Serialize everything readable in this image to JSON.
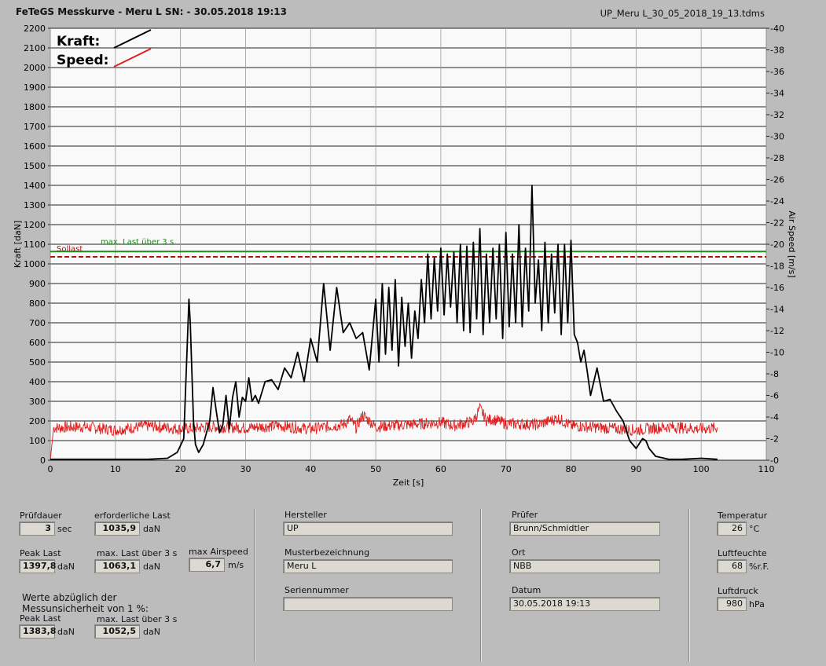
{
  "header": {
    "title": "FeTeGS Messkurve - Meru L  SN:  - 30.05.2018 19:13",
    "filename": "UP_Meru L_30_05_2018_19_13.tdms"
  },
  "chart_data": {
    "type": "line",
    "xlabel": "Zeit [s]",
    "ylabel": "Kraft [daN]",
    "y2label": "Air Speed [m/s]",
    "xlim": [
      0,
      110
    ],
    "ylim": [
      0,
      2200
    ],
    "y2lim": [
      0,
      40
    ],
    "x_ticks": [
      "0",
      "10",
      "20",
      "30",
      "40",
      "50",
      "60",
      "70",
      "80",
      "90",
      "100",
      "110"
    ],
    "y_ticks": [
      "0",
      "100",
      "200",
      "300",
      "400",
      "500",
      "600",
      "700",
      "800",
      "900",
      "1000",
      "1100",
      "1200",
      "1300",
      "1400",
      "1500",
      "1600",
      "1700",
      "1800",
      "1900",
      "2000",
      "2100",
      "2200"
    ],
    "y2_ticks": [
      "0",
      "2",
      "4",
      "6",
      "8",
      "10",
      "12",
      "14",
      "16",
      "18",
      "20",
      "22",
      "24",
      "26",
      "28",
      "30",
      "32",
      "34",
      "36",
      "38",
      "40"
    ],
    "grid": true,
    "legend": {
      "position": "top-left",
      "entries": [
        {
          "label": "Kraft:",
          "color": "#000000"
        },
        {
          "label": "Speed:",
          "color": "#e02020"
        }
      ]
    },
    "reference_lines": [
      {
        "label": "max. Last über  3 s",
        "value": 1063.1,
        "color": "#228b22",
        "style": "solid"
      },
      {
        "label": "Sollast",
        "value": 1035.9,
        "color": "#b01010",
        "style": "dashed"
      }
    ],
    "series": [
      {
        "name": "Kraft",
        "axis": "left",
        "color": "#000000",
        "x": [
          0,
          5,
          10,
          15,
          18,
          19.5,
          20.5,
          21,
          21.3,
          21.5,
          22,
          22.3,
          22.8,
          23.5,
          24.5,
          25,
          25.5,
          26,
          26.5,
          27,
          27.5,
          28,
          28.5,
          29,
          29.5,
          30,
          30.5,
          31,
          31.5,
          32,
          33,
          34,
          35,
          36,
          37,
          38,
          39,
          40,
          41,
          42,
          43,
          44,
          45,
          46,
          47,
          48,
          49,
          50,
          50.5,
          51,
          51.5,
          52,
          52.5,
          53,
          53.5,
          54,
          54.5,
          55,
          55.5,
          56,
          56.5,
          57,
          57.5,
          58,
          58.5,
          59,
          59.5,
          60,
          60.5,
          61,
          61.5,
          62,
          62.5,
          63,
          63.5,
          64,
          64.5,
          65,
          65.5,
          66,
          66.5,
          67,
          67.5,
          68,
          68.5,
          69,
          69.5,
          70,
          70.5,
          71,
          71.5,
          72,
          72.5,
          73,
          73.5,
          74,
          74.5,
          75,
          75.5,
          76,
          76.5,
          77,
          77.5,
          78,
          78.5,
          79,
          79.5,
          80,
          80.5,
          81,
          81.5,
          82,
          82.5,
          83,
          84,
          85,
          86,
          87,
          88,
          89,
          90,
          91,
          91.5,
          92,
          93,
          95,
          97,
          100,
          102.5
        ],
        "values": [
          5,
          5,
          5,
          5,
          10,
          40,
          110,
          550,
          820,
          700,
          200,
          80,
          40,
          80,
          200,
          370,
          250,
          140,
          180,
          330,
          160,
          320,
          400,
          220,
          320,
          300,
          420,
          300,
          330,
          290,
          400,
          410,
          360,
          470,
          420,
          550,
          400,
          620,
          500,
          900,
          560,
          880,
          650,
          700,
          620,
          650,
          460,
          820,
          500,
          900,
          540,
          880,
          560,
          920,
          480,
          830,
          580,
          800,
          520,
          760,
          620,
          920,
          700,
          1050,
          720,
          1030,
          760,
          1080,
          740,
          1050,
          780,
          1060,
          700,
          1100,
          660,
          1090,
          650,
          1110,
          720,
          1180,
          640,
          1050,
          700,
          1080,
          720,
          1100,
          620,
          1160,
          680,
          1050,
          700,
          1200,
          680,
          1080,
          760,
          1400,
          800,
          1020,
          660,
          1110,
          700,
          1050,
          750,
          1100,
          640,
          1100,
          700,
          1120,
          640,
          600,
          500,
          560,
          450,
          330,
          470,
          300,
          310,
          250,
          200,
          100,
          60,
          110,
          100,
          60,
          20,
          5,
          5,
          10,
          5
        ]
      },
      {
        "name": "Speed",
        "axis": "right",
        "color": "#e02020",
        "x": [
          0,
          0.5,
          5,
          10,
          15,
          20,
          25,
          30,
          35,
          40,
          45,
          46,
          47,
          48,
          50,
          55,
          60,
          62,
          65,
          66,
          67,
          68,
          70,
          75,
          78,
          80,
          85,
          90,
          95,
          100,
          102.5
        ],
        "values": [
          0,
          3,
          3.1,
          2.8,
          3.2,
          2.9,
          3.1,
          3,
          3.2,
          2.9,
          3.3,
          3.8,
          3,
          4.2,
          3.1,
          3.3,
          3.5,
          3.2,
          3.6,
          4.8,
          3.7,
          3.8,
          3.4,
          3.3,
          3.9,
          3.2,
          3,
          2.8,
          3.1,
          2.9,
          3
        ]
      }
    ]
  },
  "panel": {
    "pruefdauer": {
      "label": "Prüfdauer",
      "value": "3",
      "unit": "sec"
    },
    "erf_last": {
      "label": "erforderliche Last",
      "value": "1035,9",
      "unit": "daN"
    },
    "peak_last": {
      "label": "Peak Last",
      "value": "1397,8",
      "unit": "daN"
    },
    "max_last": {
      "label": "max. Last über  3 s",
      "value": "1063,1",
      "unit": "daN"
    },
    "max_airspeed": {
      "label": "max Airspeed",
      "value": "6,7",
      "unit": "m/s"
    },
    "note_line1": "Werte abzüglich der",
    "note_line2": "Messunsicherheit von 1  %:",
    "peak_last2": {
      "label": "Peak Last",
      "value": "1383,8",
      "unit": "daN"
    },
    "max_last2": {
      "label": "max. Last über  3 s",
      "value": "1052,5",
      "unit": "daN"
    },
    "hersteller": {
      "label": "Hersteller",
      "value": "UP"
    },
    "muster": {
      "label": "Musterbezeichnung",
      "value": "Meru L"
    },
    "serien": {
      "label": "Seriennummer",
      "value": ""
    },
    "pruefer": {
      "label": "Prüfer",
      "value": "Brunn/Schmidtler"
    },
    "ort": {
      "label": "Ort",
      "value": "NBB"
    },
    "datum": {
      "label": "Datum",
      "value": "30.05.2018 19:13"
    },
    "temperatur": {
      "label": "Temperatur",
      "value": "26",
      "unit": "°C"
    },
    "luftfeuchte": {
      "label": "Luftfeuchte",
      "value": "68",
      "unit": "%r.F."
    },
    "luftdruck": {
      "label": "Luftdruck",
      "value": "980",
      "unit": "hPa"
    }
  }
}
